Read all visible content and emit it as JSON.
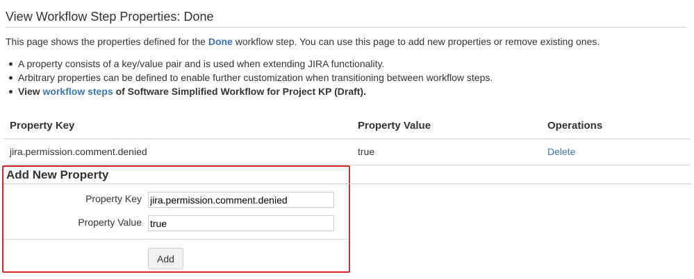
{
  "page": {
    "title": "View Workflow Step Properties: Done"
  },
  "intro": {
    "prefix": "This page shows the properties defined for the ",
    "step_name": "Done",
    "suffix": " workflow step. You can use this page to add new properties or remove existing ones."
  },
  "bullets": {
    "item1": "A property consists of a key/value pair and is used when extending JIRA functionality.",
    "item2": "Arbitrary properties can be defined to enable further customization when transitioning between workflow steps.",
    "item3_prefix": "View ",
    "item3_link": "workflow steps",
    "item3_suffix": " of Software Simplified Workflow for Project KP (Draft)."
  },
  "table": {
    "headers": {
      "key": "Property Key",
      "value": "Property Value",
      "operations": "Operations"
    },
    "rows": [
      {
        "key": "jira.permission.comment.denied",
        "value": "true",
        "operation": "Delete"
      }
    ]
  },
  "add_form": {
    "title": "Add New Property",
    "key_label": "Property Key",
    "key_value": "jira.permission.comment.denied",
    "value_label": "Property Value",
    "value_value": "true",
    "submit_label": "Add"
  },
  "colors": {
    "link": "#3b73af",
    "highlight_border": "#e0242b"
  }
}
